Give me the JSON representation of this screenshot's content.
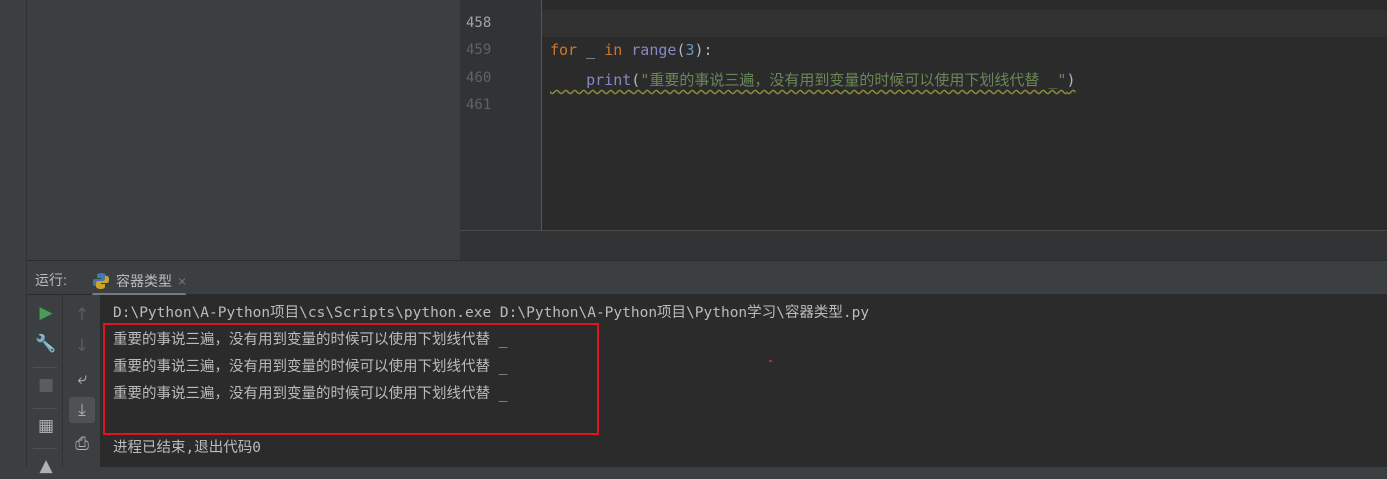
{
  "editor": {
    "line_numbers": [
      "458",
      "459",
      "460",
      "461"
    ],
    "line_459": {
      "kw_for": "for",
      "var": " _ ",
      "kw_in": "in",
      "fn": " range",
      "open": "(",
      "num": "3",
      "close": "):"
    },
    "line_460": {
      "indent": "    ",
      "fn": "print",
      "open": "(",
      "str": "\"重要的事说三遍，没有用到变量的时候可以使用下划线代替 _\"",
      "close": ")"
    }
  },
  "run": {
    "label": "运行:",
    "tab": "容器类型",
    "close": "×"
  },
  "console": {
    "command": "D:\\Python\\A-Python项目\\cs\\Scripts\\python.exe D:\\Python\\A-Python项目\\Python学习\\容器类型.py",
    "outputs": [
      "重要的事说三遍，没有用到变量的时候可以使用下划线代替 _",
      "重要的事说三遍，没有用到变量的时候可以使用下划线代替 _",
      "重要的事说三遍，没有用到变量的时候可以使用下划线代替 _"
    ],
    "exit": "进程已结束,退出代码0"
  },
  "colors": {
    "highlight_box": "#e0141e",
    "run_green": "#499c54"
  }
}
